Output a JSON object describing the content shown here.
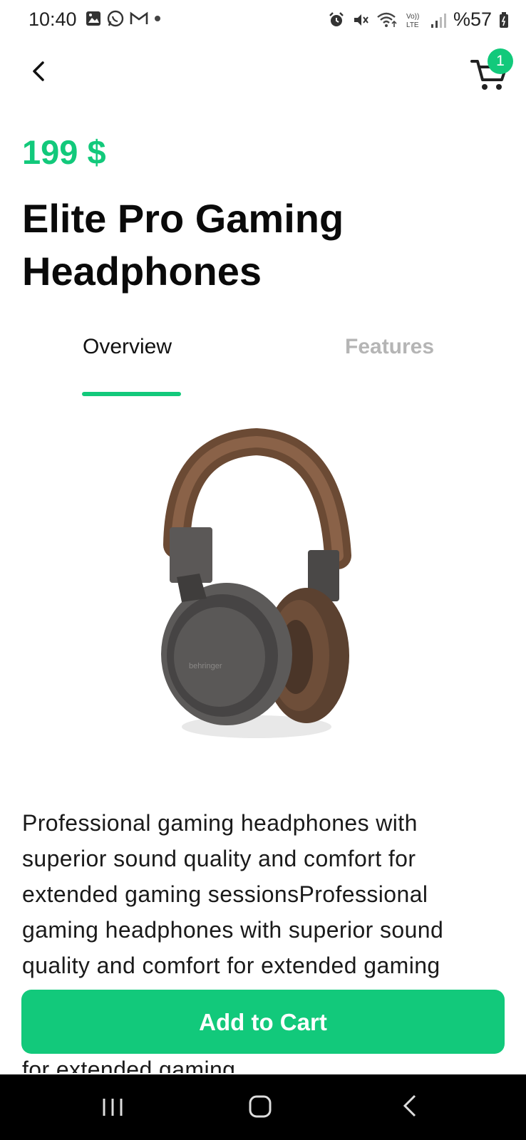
{
  "status_bar": {
    "time": "10:40",
    "battery": "%57",
    "icons": [
      "gallery-icon",
      "whatsapp-icon",
      "gmail-icon",
      "dot-icon",
      "alarm-icon",
      "mute-icon",
      "wifi-icon",
      "volte-icon",
      "signal-icon",
      "battery-icon"
    ]
  },
  "header": {
    "back_icon": "chevron-left-icon",
    "cart_icon": "cart-icon",
    "cart_count": "1"
  },
  "product": {
    "price": "199 $",
    "title": "Elite Pro Gaming Headphones",
    "description": "Professional gaming headphones with superior sound quality and comfort for extended gaming sessionsProfessional gaming headphones with superior sound quality and comfort for extended gaming",
    "description_overflow": "for extended gaming",
    "image_icon": "headphones-image",
    "brand_mark": "behringer"
  },
  "tabs": [
    {
      "label": "Overview",
      "active": true
    },
    {
      "label": "Features",
      "active": false
    }
  ],
  "actions": {
    "add_to_cart": "Add to Cart"
  },
  "colors": {
    "accent": "#12c97b",
    "inactive_tab": "#b5b5b5",
    "nav_bar": "#000000"
  }
}
